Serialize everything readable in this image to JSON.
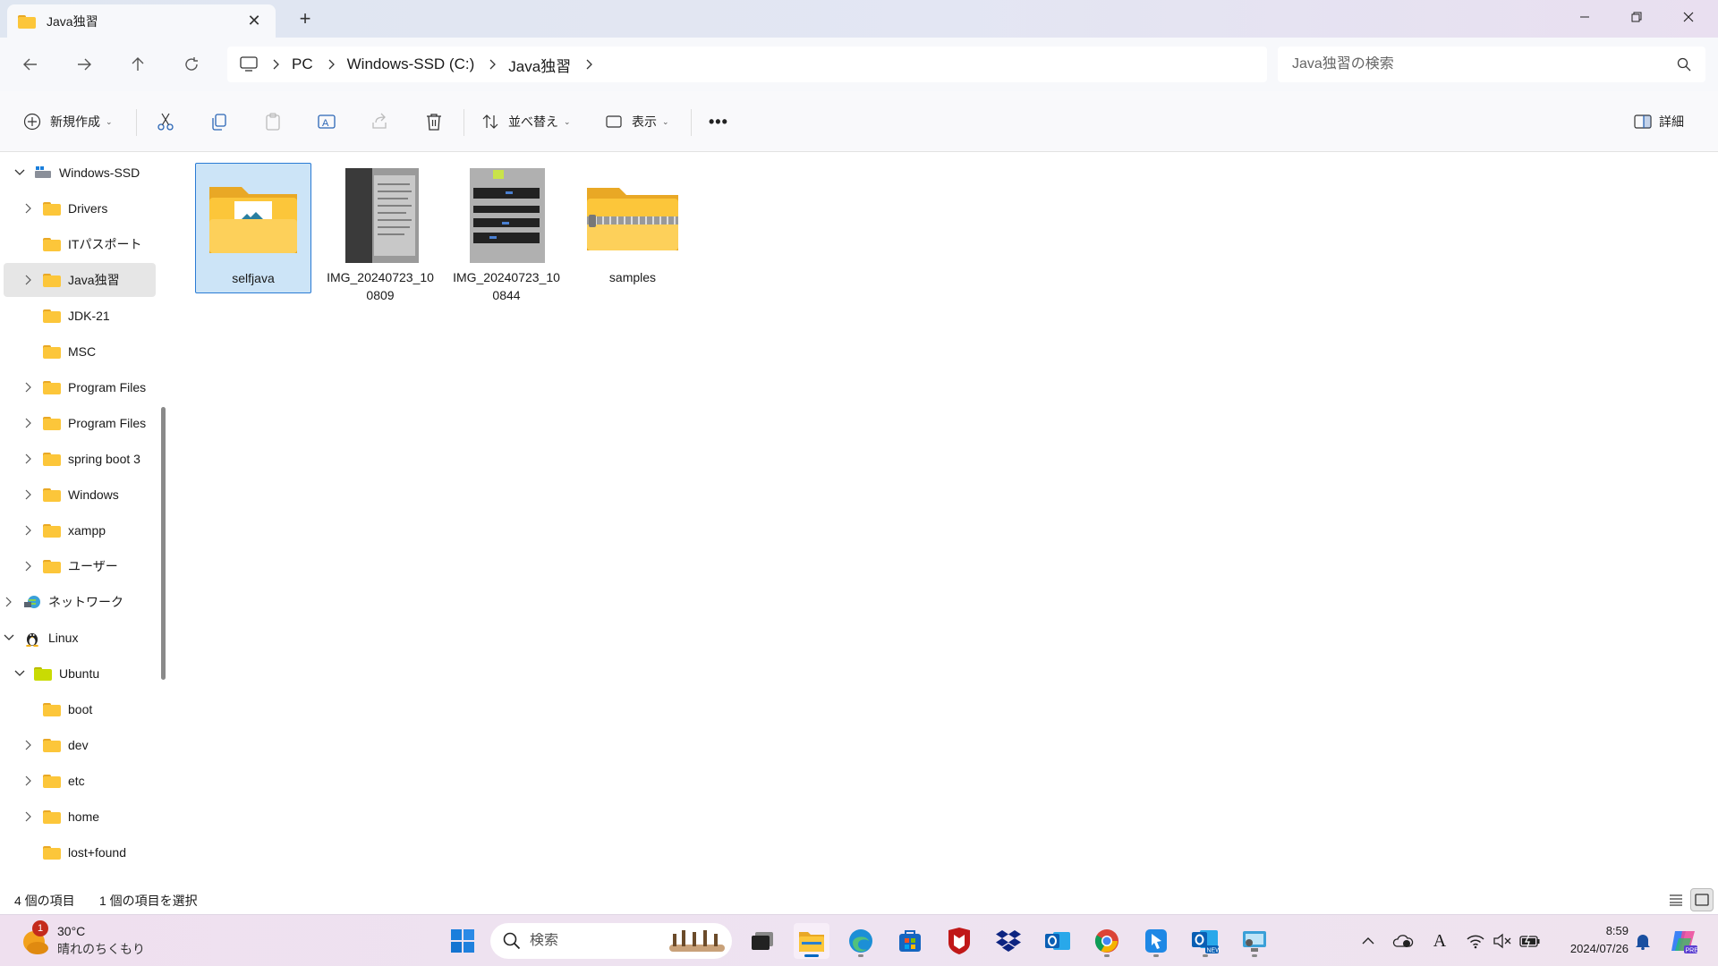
{
  "window": {
    "tab_title": "Java独習",
    "new_tab": "+"
  },
  "address": {
    "crumbs": [
      "PC",
      "Windows-SSD (C:)",
      "Java独習"
    ],
    "search_placeholder": "Java独習の検索"
  },
  "toolbar": {
    "new_label": "新規作成",
    "sort_label": "並べ替え",
    "view_label": "表示",
    "more_label": "•••",
    "details_label": "詳細"
  },
  "sidebar": {
    "items": [
      {
        "label": "Windows-SSD",
        "icon": "drive-icon",
        "expanded": true
      },
      {
        "label": "Drivers",
        "icon": "folder-icon",
        "expandable": true
      },
      {
        "label": "ITパスポート",
        "icon": "folder-icon",
        "expandable": false
      },
      {
        "label": "Java独習",
        "icon": "folder-icon",
        "expandable": true,
        "selected": true
      },
      {
        "label": "JDK-21",
        "icon": "folder-icon",
        "expandable": false
      },
      {
        "label": "MSC",
        "icon": "folder-icon",
        "expandable": false
      },
      {
        "label": "Program Files",
        "icon": "folder-icon",
        "expandable": true
      },
      {
        "label": "Program Files",
        "icon": "folder-icon",
        "expandable": true
      },
      {
        "label": "spring boot 3",
        "icon": "folder-icon",
        "expandable": true
      },
      {
        "label": "Windows",
        "icon": "folder-icon",
        "expandable": true
      },
      {
        "label": "xampp",
        "icon": "folder-icon",
        "expandable": true
      },
      {
        "label": "ユーザー",
        "icon": "folder-icon",
        "expandable": true
      },
      {
        "label": "ネットワーク",
        "icon": "network-icon",
        "expandable": true
      },
      {
        "label": "Linux",
        "icon": "linux-icon",
        "expanded": true
      },
      {
        "label": "Ubuntu",
        "icon": "folder-icon",
        "expanded": true
      },
      {
        "label": "boot",
        "icon": "folder-icon",
        "expandable": false
      },
      {
        "label": "dev",
        "icon": "folder-icon",
        "expandable": true
      },
      {
        "label": "etc",
        "icon": "folder-icon",
        "expandable": true
      },
      {
        "label": "home",
        "icon": "folder-icon",
        "expandable": true
      },
      {
        "label": "lost+found",
        "icon": "folder-icon",
        "expandable": false
      }
    ]
  },
  "files": [
    {
      "name": "selfjava",
      "type": "folder",
      "selected": true
    },
    {
      "name": "IMG_20240723_100809",
      "type": "image"
    },
    {
      "name": "IMG_20240723_100844",
      "type": "image"
    },
    {
      "name": "samples",
      "type": "zip-folder"
    }
  ],
  "status": {
    "item_count": "4 個の項目",
    "selected_count": "1 個の項目を選択"
  },
  "taskbar": {
    "weather_temp": "30°C",
    "weather_desc": "晴れのちくもり",
    "weather_badge": "1",
    "search_placeholder": "検索",
    "time": "8:59",
    "date": "2024/07/26"
  },
  "colors": {
    "accent": "#0067c0",
    "folder": "#fcc63a",
    "selection": "#cce4f7",
    "mcafee": "#c01818",
    "dropbox": "#0d2481"
  }
}
